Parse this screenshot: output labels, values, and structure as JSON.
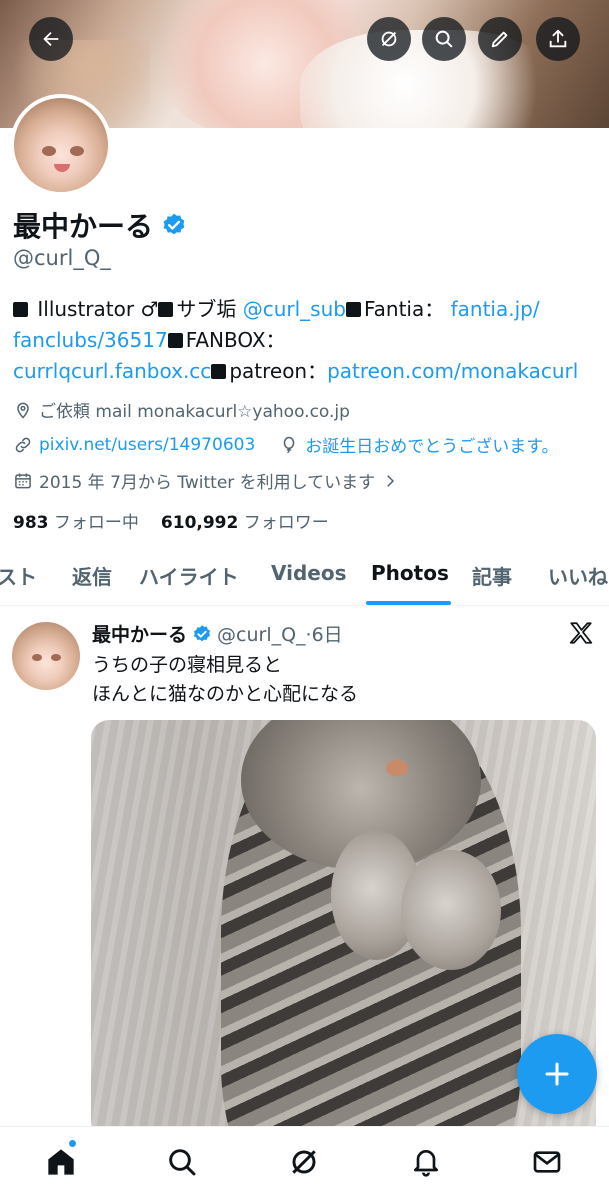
{
  "header": {
    "back_icon": "arrow-left-icon",
    "grok_icon": "grok-icon",
    "search_icon": "search-icon",
    "edit_icon": "pencil-icon",
    "share_icon": "share-icon"
  },
  "profile": {
    "display_name": "最中かーる",
    "handle": "@curl_Q_",
    "bio": {
      "p1": "Illustrator ♂",
      "p2": "サブ垢",
      "sub_link": "@curl_sub",
      "p3": "Fantia：",
      "fantia_link_1": "fantia.jp/",
      "fantia_link_2": "fanclubs/36517",
      "p4": "FANBOX：",
      "fanbox_link": "currlqcurl.fanbox.cc",
      "p5": "patreon：",
      "patreon_link": "patreon.com/monakacurl"
    },
    "location": "ご依頼 mail monakacurl☆yahoo.co.jp",
    "website": "pixiv.net/users/14970603",
    "birthday": "お誕生日おめでとうございます。",
    "joined": "2015 年 7月から Twitter を利用しています",
    "following_count": "983",
    "following_label": "フォロー中",
    "followers_count": "610,992",
    "followers_label": "フォロワー"
  },
  "tabs": [
    {
      "label": "スト"
    },
    {
      "label": "返信"
    },
    {
      "label": "ハイライト"
    },
    {
      "label": "Videos"
    },
    {
      "label": "Photos"
    },
    {
      "label": "記事"
    },
    {
      "label": "いいね"
    }
  ],
  "active_tab": "Photos",
  "tweet": {
    "name": "最中かーる",
    "handle_time": "@curl_Q_·6日",
    "line1": "うちの子の寝相見ると",
    "line2": "ほんとに猫なのかと心配になる"
  },
  "colors": {
    "accent": "#1d9bf0",
    "text": "#0f1419",
    "secondary": "#536471"
  },
  "bottom_nav": [
    "home-icon",
    "search-icon",
    "grok-icon",
    "bell-icon",
    "mail-icon"
  ]
}
